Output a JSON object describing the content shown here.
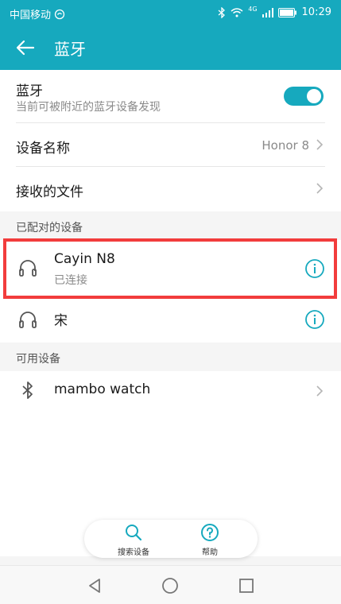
{
  "status_bar": {
    "carrier": "中国移动",
    "time": "10:29",
    "network": "4G"
  },
  "app_bar": {
    "title": "蓝牙"
  },
  "bluetooth_row": {
    "title": "蓝牙",
    "subtitle": "当前可被附近的蓝牙设备发现",
    "enabled": true
  },
  "device_name_row": {
    "title": "设备名称",
    "value": "Honor 8"
  },
  "received_files_row": {
    "title": "接收的文件"
  },
  "paired_section": {
    "header": "已配对的设备",
    "devices": [
      {
        "name": "Cayin N8",
        "status": "已连接",
        "icon": "headphones-icon"
      },
      {
        "name": "宋",
        "status": "",
        "icon": "headphones-icon"
      }
    ]
  },
  "available_section": {
    "header": "可用设备",
    "devices": [
      {
        "name": "mambo watch",
        "icon": "bluetooth-icon"
      }
    ]
  },
  "bottom_actions": {
    "search": "搜索设备",
    "help": "帮助"
  },
  "colors": {
    "accent": "#16a9be",
    "highlight": "#f23c3c"
  }
}
